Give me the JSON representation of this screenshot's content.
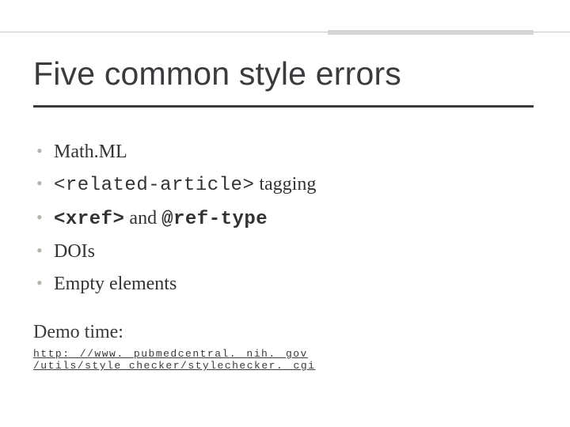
{
  "title": "Five common style errors",
  "bullets": {
    "b1": "Math.ML",
    "b2_code": "<related-article>",
    "b2_rest": " tagging",
    "b3_code1": "<xref>",
    "b3_mid": " and ",
    "b3_code2": "@ref-type",
    "b4": "DOIs",
    "b5": "Empty elements"
  },
  "demo_label": "Demo time:",
  "demo_url": "http: //www. pubmedcentral. nih. gov /utils/style_checker/stylechecker. cgi"
}
